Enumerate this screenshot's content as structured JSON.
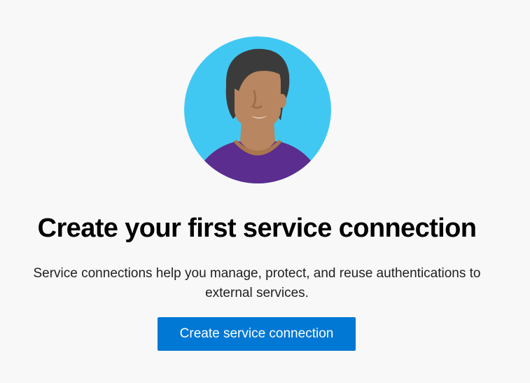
{
  "empty_state": {
    "illustration_icon": "person-avatar-illustration",
    "title": "Create your first service connection",
    "description_line1": "Service connections help you manage, protect, and reuse authentications to",
    "description_line2": "external services.",
    "primary_button_label": "Create service connection"
  },
  "colors": {
    "background": "#f8f8f8",
    "avatar_circle": "#41c8f2",
    "accent_button": "#0078d4",
    "shirt": "#5b2d8e",
    "skin": "#b88660",
    "hair": "#3b3b3b"
  }
}
